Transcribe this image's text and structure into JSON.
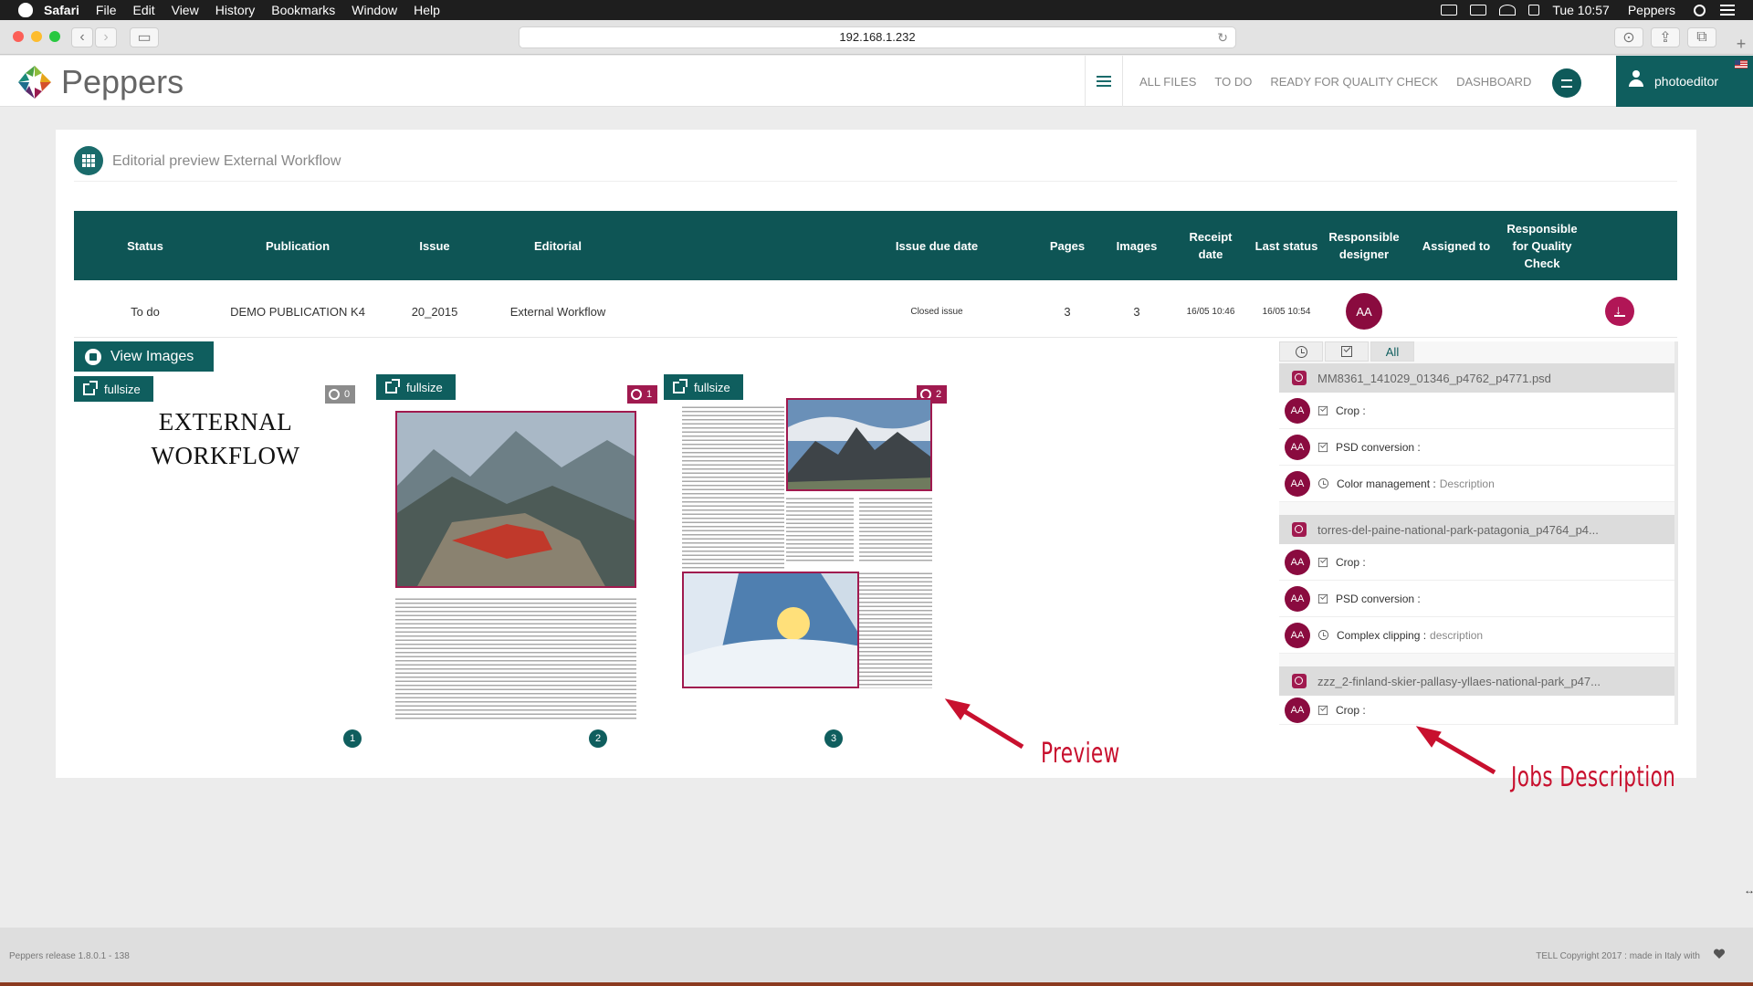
{
  "menubar": {
    "app": "Safari",
    "items": [
      "File",
      "Edit",
      "View",
      "History",
      "Bookmarks",
      "Window",
      "Help"
    ],
    "clock": "Tue 10:57",
    "user": "Peppers"
  },
  "browser": {
    "url": "192.168.1.232"
  },
  "header": {
    "brand": "Peppers",
    "nav": [
      "ALL FILES",
      "TO DO",
      "READY FOR QUALITY CHECK",
      "DASHBOARD"
    ],
    "username": "photoeditor"
  },
  "page": {
    "title": "Editorial preview External Workflow"
  },
  "table": {
    "headers": [
      "Status",
      "Publication",
      "Issue",
      "Editorial",
      "Issue due date",
      "Pages",
      "Images",
      "Receipt date",
      "Last status",
      "Responsible designer",
      "Assigned to",
      "Responsible for Quality Check"
    ],
    "row": {
      "status": "To do",
      "publication": "DEMO PUBLICATION K4",
      "issue": "20_2015",
      "editorial": "External Workflow",
      "due": "Closed issue",
      "pages": "3",
      "images": "3",
      "receipt": "16/05 10:46",
      "last_status": "16/05 10:54",
      "designer": "AA"
    }
  },
  "preview": {
    "view_images": "View Images",
    "fullsize": "fullsize",
    "page1_title": "EXTERNAL WORKFLOW",
    "badges": [
      "0",
      "1",
      "2"
    ],
    "page_numbers": [
      "1",
      "2",
      "3"
    ]
  },
  "jobs": {
    "tabs": [
      "All"
    ],
    "groups": [
      {
        "file": "MM8361_141029_01346_p4762_p4771.psd",
        "rows": [
          {
            "avatar": "AA",
            "label": "Crop :",
            "desc": ""
          },
          {
            "avatar": "AA",
            "label": "PSD conversion :",
            "desc": ""
          },
          {
            "avatar": "AA",
            "label": "Color management :",
            "desc": "Description"
          }
        ]
      },
      {
        "file": "torres-del-paine-national-park-patagonia_p4764_p4...",
        "rows": [
          {
            "avatar": "AA",
            "label": "Crop :",
            "desc": ""
          },
          {
            "avatar": "AA",
            "label": "PSD conversion :",
            "desc": ""
          },
          {
            "avatar": "AA",
            "label": "Complex clipping :",
            "desc": "description"
          }
        ]
      },
      {
        "file": "zzz_2-finland-skier-pallasy-yllaes-national-park_p47...",
        "rows": [
          {
            "avatar": "AA",
            "label": "Crop :",
            "desc": ""
          }
        ]
      }
    ]
  },
  "annotations": {
    "preview": "Preview",
    "jobs": "Jobs Description"
  },
  "footer": {
    "release": "Peppers release 1.8.0.1 - 138",
    "copyright": "TELL Copyright 2017 : made in Italy with"
  },
  "colors": {
    "teal": "#0f5e5e",
    "magenta": "#8a0b3f",
    "annotation_red": "#c8102e"
  }
}
